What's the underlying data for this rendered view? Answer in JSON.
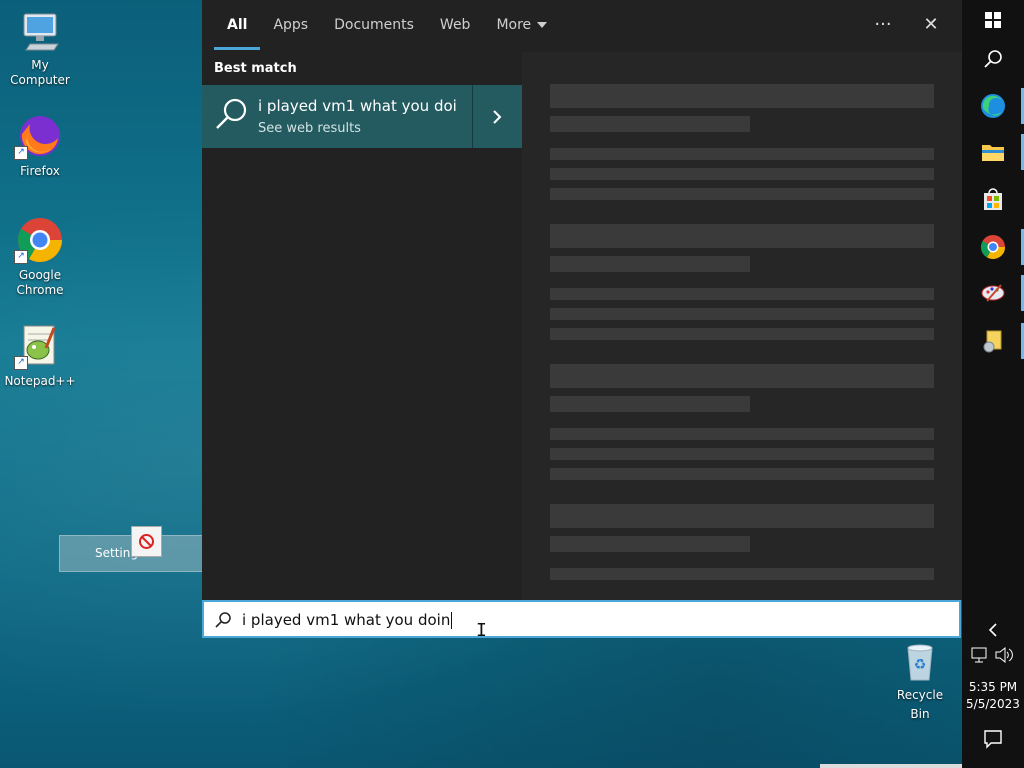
{
  "desktop": {
    "icons": [
      {
        "label": "My Computer"
      },
      {
        "label": "Firefox"
      },
      {
        "label": "Google Chrome"
      },
      {
        "label": "Notepad++"
      }
    ],
    "recycle_bin": {
      "label": "Recycle Bin"
    },
    "drag_ghost": {
      "label": "Setting"
    }
  },
  "search_panel": {
    "tabs": [
      {
        "label": "All",
        "active": true
      },
      {
        "label": "Apps"
      },
      {
        "label": "Documents"
      },
      {
        "label": "Web"
      },
      {
        "label": "More"
      }
    ],
    "more_options_glyph": "···",
    "close_glyph": "✕",
    "best_match_label": "Best match",
    "best_match": {
      "title": "i played vm1 what you doi",
      "subtitle": "See web results"
    }
  },
  "search_box": {
    "query": "i played vm1 what you doin"
  },
  "taskbar": {
    "time": "5:35 PM",
    "date": "5/5/2023",
    "icons": [
      "windows-start",
      "search",
      "edge",
      "file-explorer",
      "microsoft-store",
      "chrome",
      "paint",
      "notes"
    ],
    "accent": "#76b9ed"
  },
  "colors": {
    "panel_bg": "#222222",
    "result_bg": "#245b60",
    "accent_blue": "#4aa7d8"
  }
}
